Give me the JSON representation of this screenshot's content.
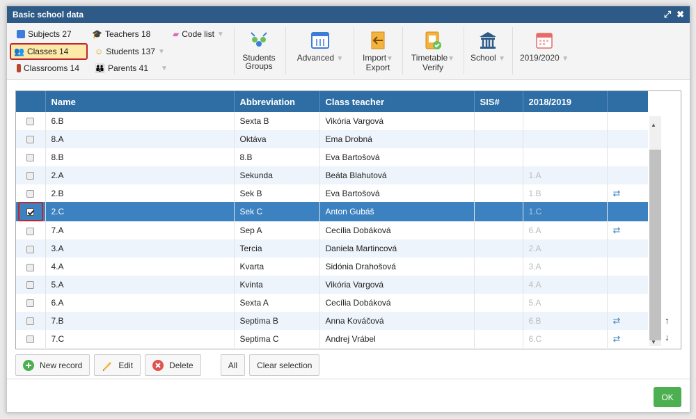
{
  "window": {
    "title": "Basic school data"
  },
  "nav": {
    "subjects": "Subjects 27",
    "teachers": "Teachers 18",
    "code_list": "Code list",
    "classes": "Classes 14",
    "students": "Students 137",
    "classrooms": "Classrooms 14",
    "parents": "Parents 41"
  },
  "toolbar": {
    "students_groups_1": "Students",
    "students_groups_2": "Groups",
    "advanced": "Advanced",
    "import_1": "Import",
    "import_2": "Export",
    "timetable_1": "Timetable",
    "timetable_2": "Verify",
    "school": "School",
    "year": "2019/2020"
  },
  "table": {
    "headers": [
      "Name",
      "Abbreviation",
      "Class teacher",
      "SIS#",
      "2018/2019"
    ],
    "rows": [
      {
        "name": "6.B",
        "abbr": "Sexta B",
        "teacher": "Vikória Vargová",
        "sis": "",
        "prev": "",
        "swap": false,
        "checked": false
      },
      {
        "name": "8.A",
        "abbr": "Oktáva",
        "teacher": "Ema Drobná",
        "sis": "",
        "prev": "",
        "swap": false,
        "checked": false
      },
      {
        "name": "8.B",
        "abbr": "8.B",
        "teacher": "Eva Bartošová",
        "sis": "",
        "prev": "",
        "swap": false,
        "checked": false
      },
      {
        "name": "2.A",
        "abbr": "Sekunda",
        "teacher": "Beáta Blahutová",
        "sis": "",
        "prev": "1.A",
        "swap": false,
        "checked": false
      },
      {
        "name": "2.B",
        "abbr": "Sek B",
        "teacher": "Eva Bartošová",
        "sis": "",
        "prev": "1.B",
        "swap": true,
        "checked": false
      },
      {
        "name": "2.C",
        "abbr": "Sek C",
        "teacher": "Anton Gubáš",
        "sis": "",
        "prev": "1.C",
        "swap": true,
        "checked": true
      },
      {
        "name": "7.A",
        "abbr": "Sep A",
        "teacher": "Cecília Dobáková",
        "sis": "",
        "prev": "6.A",
        "swap": true,
        "checked": false
      },
      {
        "name": "3.A",
        "abbr": "Tercia",
        "teacher": "Daniela Martincová",
        "sis": "",
        "prev": "2.A",
        "swap": false,
        "checked": false
      },
      {
        "name": "4.A",
        "abbr": "Kvarta",
        "teacher": "Sidónia Drahošová",
        "sis": "",
        "prev": "3.A",
        "swap": false,
        "checked": false
      },
      {
        "name": "5.A",
        "abbr": "Kvinta",
        "teacher": "Vikória Vargová",
        "sis": "",
        "prev": "4.A",
        "swap": false,
        "checked": false
      },
      {
        "name": "6.A",
        "abbr": "Sexta A",
        "teacher": "Cecília Dobáková",
        "sis": "",
        "prev": "5.A",
        "swap": false,
        "checked": false
      },
      {
        "name": "7.B",
        "abbr": "Septima B",
        "teacher": "Anna Kováčová",
        "sis": "",
        "prev": "6.B",
        "swap": true,
        "checked": false
      },
      {
        "name": "7.C",
        "abbr": "Septima C",
        "teacher": "Andrej Vrábel",
        "sis": "",
        "prev": "6.C",
        "swap": true,
        "checked": false
      }
    ]
  },
  "buttons": {
    "new_record": "New record",
    "edit": "Edit",
    "delete": "Delete",
    "all": "All",
    "clear_selection": "Clear selection",
    "ok": "OK"
  },
  "colors": {
    "header": "#2e5a87",
    "selected_row": "#3d82c0",
    "highlight": "#c0262b",
    "ok": "#4caf50"
  }
}
